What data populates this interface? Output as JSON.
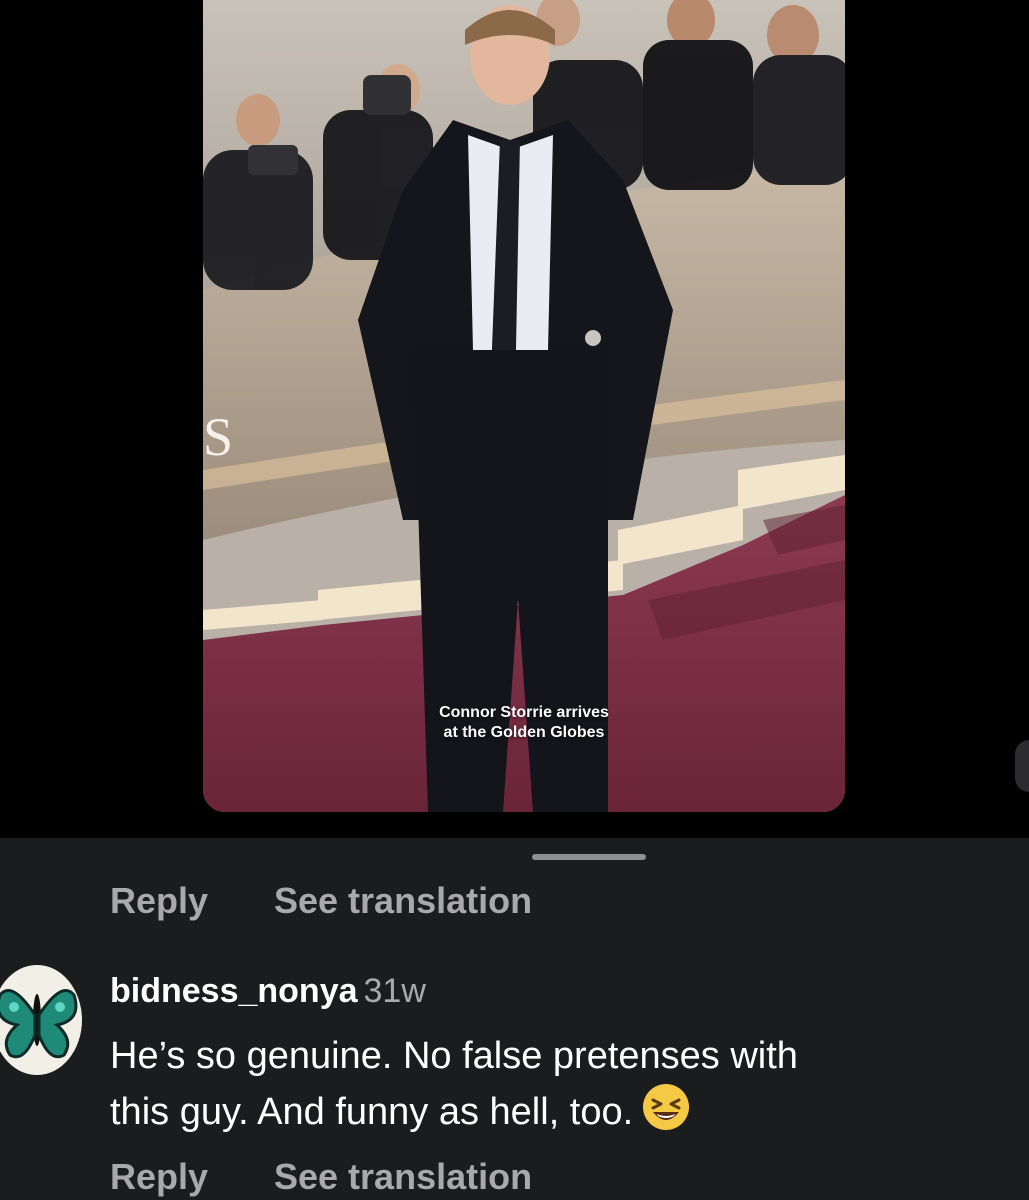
{
  "video": {
    "caption_line1": "Connor Storrie arrives",
    "caption_line2": "at the Golden Globes",
    "wall_letter": "S"
  },
  "actions_top": {
    "reply_label": "Reply",
    "translate_label": "See translation"
  },
  "comment": {
    "username": "bidness_nonya",
    "timestamp": "31w",
    "text_line1": "He’s so genuine. No false pretenses with",
    "text_line2": "this guy. And funny as hell, too.",
    "emoji": "laughing-face-emoji",
    "avatar_icon": "butterfly-icon"
  },
  "actions_bottom": {
    "reply_label": "Reply",
    "translate_label": "See translation"
  },
  "colors": {
    "background": "#000000",
    "sheet": "#1a1c1e",
    "muted_text": "#a8a8ad",
    "carpet": "#7a2f45"
  }
}
